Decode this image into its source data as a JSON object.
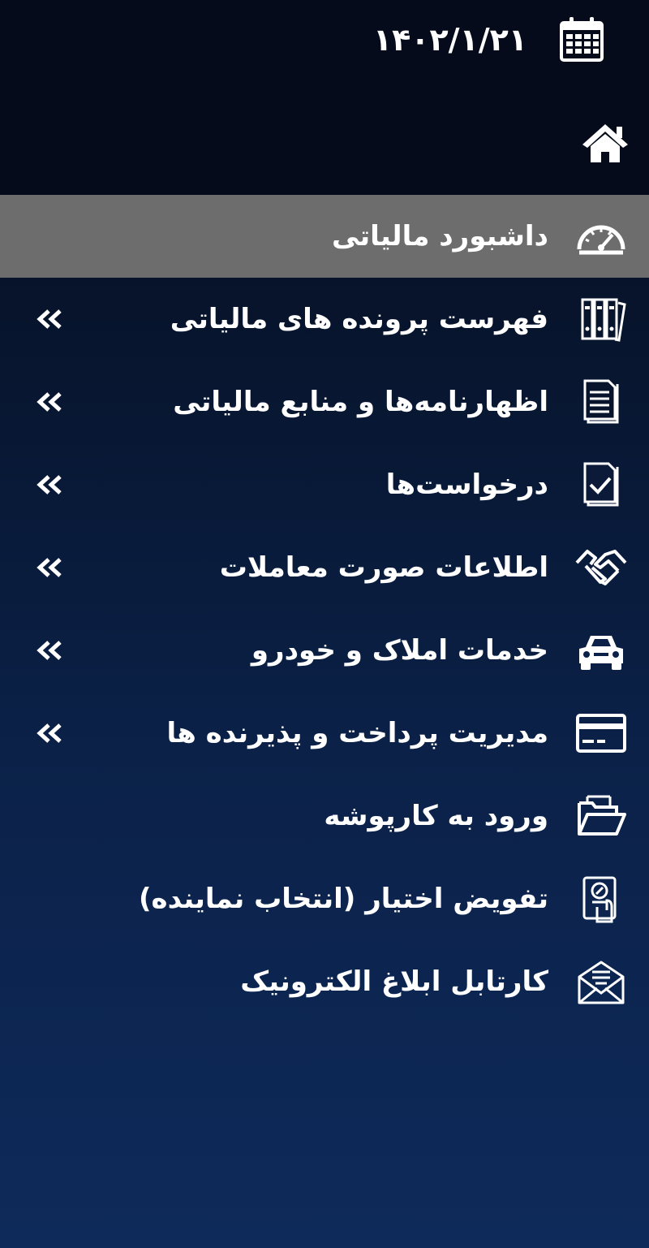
{
  "header": {
    "date": "۱۴۰۲/۱/۲۱"
  },
  "menu": [
    {
      "label": "داشبورد مالیاتی",
      "icon": "dashboard-gauge-icon",
      "active": true,
      "submenu": false
    },
    {
      "label": "فهرست پرونده های مالیاتی",
      "icon": "binders-icon",
      "active": false,
      "submenu": true
    },
    {
      "label": "اظهارنامه‌ها و منابع مالیاتی",
      "icon": "document-icon",
      "active": false,
      "submenu": true
    },
    {
      "label": "درخواست‌ها",
      "icon": "document-check-icon",
      "active": false,
      "submenu": true
    },
    {
      "label": "اطلاعات صورت معاملات",
      "icon": "handshake-icon",
      "active": false,
      "submenu": true
    },
    {
      "label": "خدمات املاک و خودرو",
      "icon": "car-icon",
      "active": false,
      "submenu": true
    },
    {
      "label": "مدیریت پرداخت و پذیرنده ها",
      "icon": "credit-card-icon",
      "active": false,
      "submenu": true
    },
    {
      "label": "ورود به کارپوشه",
      "icon": "folder-icon",
      "active": false,
      "submenu": false
    },
    {
      "label": "تفویض اختیار (انتخاب نماینده)",
      "icon": "delegation-icon",
      "active": false,
      "submenu": false
    },
    {
      "label": "کارتابل ابلاغ الکترونیک",
      "icon": "envelope-icon",
      "active": false,
      "submenu": false
    }
  ],
  "colors": {
    "background_top": "#050b1a",
    "background_bottom": "#0e2a5a",
    "active_item": "#6d6d6d",
    "text": "#ffffff"
  }
}
